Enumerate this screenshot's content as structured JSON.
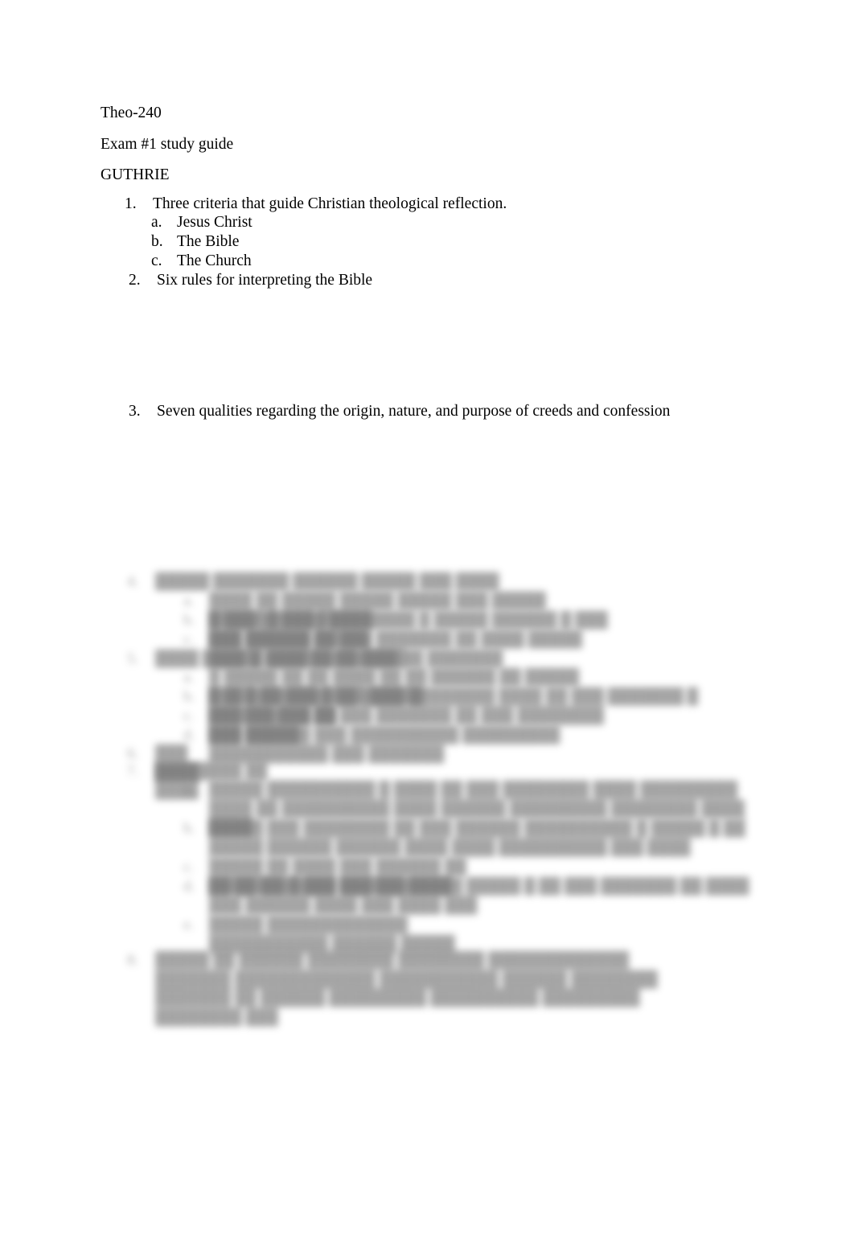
{
  "document": {
    "title": "Theo-240",
    "header_lines": [
      "Theo-240",
      "Exam #1 study guide",
      "GUTHRIE"
    ]
  },
  "outline": {
    "items": [
      {
        "marker": "1.",
        "text": "Three criteria that guide Christian theological reflection.",
        "subitems": [
          {
            "marker": "a.",
            "text": "Jesus Christ"
          },
          {
            "marker": "b.",
            "text": "The Bible"
          },
          {
            "marker": "c.",
            "text": "The Church"
          }
        ]
      },
      {
        "marker": "2.",
        "text": "Six rules for interpreting the Bible",
        "subitems": []
      },
      {
        "marker": "3.",
        "text": "Seven qualities regarding the origin, nature, and purpose of creeds and confession",
        "subitems": []
      }
    ]
  },
  "redacted_region": {
    "note": "lower portion of page is visually blurred and illegible",
    "blocks": [
      {
        "marker": "4.",
        "text": "█████ ███████ ██████ █████ ███ ████",
        "subitems": [
          {
            "marker": "a.",
            "text": "████ ██ █████ █████ █████ ███ █████ █████ █ ███ █████"
          },
          {
            "marker": "b.",
            "text": "█ ███ ██████ ████████ █ █████ ██████ █ ███ ███ ██████ █████"
          },
          {
            "marker": "c.",
            "text": "███ ██████ ██ ███ ███████ ██ ████ █████ █████ ██████ ██ ████"
          }
        ]
      },
      {
        "marker": "5.",
        "text": "████ ████ █ ████ ████████ ██ ███████",
        "subitems": [
          {
            "marker": "a.",
            "text": "█ █████ ██ ██ ████ ██ ██ ██████ ██ █████ █ ███ ██ ███ ████ █████"
          },
          {
            "marker": "b.",
            "text": "███ ████████ ██ ████ ████████ ████ ██ ███ ███████ █ ██████ ███ ██ ███ ███████ ██ ███ ████████"
          },
          {
            "marker": "c.",
            "text": "███ ██████ ██ ███ █████"
          },
          {
            "marker": "d.",
            "text": "███ ██████ ███ ██████████ █████████ ███████████ ███ ███████"
          }
        ]
      },
      {
        "marker": "6.",
        "text": "███ ████",
        "subitems": []
      },
      {
        "marker": "7.",
        "text": "████████ ██ ████",
        "subitems": [
          {
            "marker": "a.",
            "text": "█████ ██████████ █ ████ ██ ███ ████████ ████ █████████ ████ ██ ██████████ ████ ██████ █████████ ████████ ████ ████"
          },
          {
            "marker": "b.",
            "text": "█████ ███ ████████ ██ ███ ██████ ██████████ █ █████ █ ██ █████ ██████ ██████ ████ ████ ██████████ ███ ████"
          },
          {
            "marker": "c.",
            "text": "█████ ██ ████ ███ ██████ ██ ███████ █ ███ ██████ ████"
          },
          {
            "marker": "d.",
            "text": "██ ██ ███████ ███ ████████ █████ █ ██ ███ ███████ ██ ████ ███ ██████ ████ ███ ████ ███"
          },
          {
            "marker": "e.",
            "text": "█████ █████████████ ███████████ ██████ █████"
          }
        ]
      },
      {
        "marker": "8.",
        "text": "█████ ██ ██████ ████████ ████████ █████████████ ███████ █████████████ ███████████ ██████ ████████ ███████ ██ ██████ █████████ ██████████ █████████ ████████ ███",
        "subitems": []
      }
    ]
  }
}
